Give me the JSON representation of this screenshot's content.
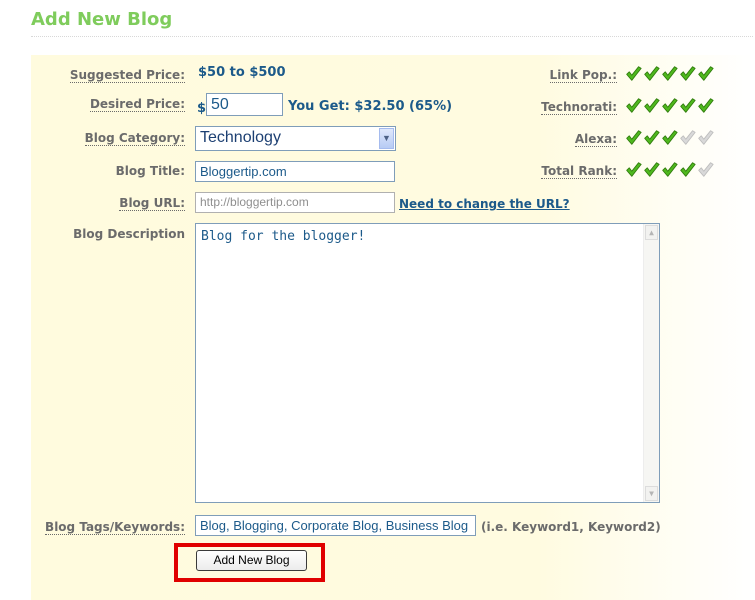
{
  "heading": "Add New Blog",
  "form": {
    "suggested_price": {
      "label": "Suggested Price:",
      "value": "$50 to $500"
    },
    "desired_price": {
      "label": "Desired Price:",
      "currency": "$",
      "value": "50",
      "you_get": "You Get: $32.50 (65%)"
    },
    "blog_category": {
      "label": "Blog Category:",
      "value": "Technology"
    },
    "blog_title": {
      "label": "Blog Title:",
      "value": "Bloggertip.com"
    },
    "blog_url": {
      "label": "Blog URL:",
      "value": "http://bloggertip.com",
      "link": "Need to change the URL?"
    },
    "blog_description": {
      "label": "Blog Description",
      "value": "Blog for the blogger!"
    },
    "blog_tags": {
      "label": "Blog Tags/Keywords:",
      "value": "Blog, Blogging, Corporate Blog, Business Blog",
      "hint": "(i.e. Keyword1, Keyword2)"
    },
    "submit_label": "Add New Blog"
  },
  "ratings": [
    {
      "label": "Link Pop.:",
      "filled": 5,
      "total": 5
    },
    {
      "label": "Technorati:",
      "filled": 5,
      "total": 5
    },
    {
      "label": "Alexa:",
      "filled": 3,
      "total": 5
    },
    {
      "label": "Total Rank:",
      "filled": 4,
      "total": 5
    }
  ],
  "colors": {
    "check_filled": "#4fb81e",
    "check_empty": "#d9d9d9",
    "highlight_box": "#e00000"
  },
  "icons": {
    "check": "check-icon",
    "dropdown": "chevron-down-icon",
    "scroll_up": "scroll-up-icon",
    "scroll_down": "scroll-down-icon"
  }
}
